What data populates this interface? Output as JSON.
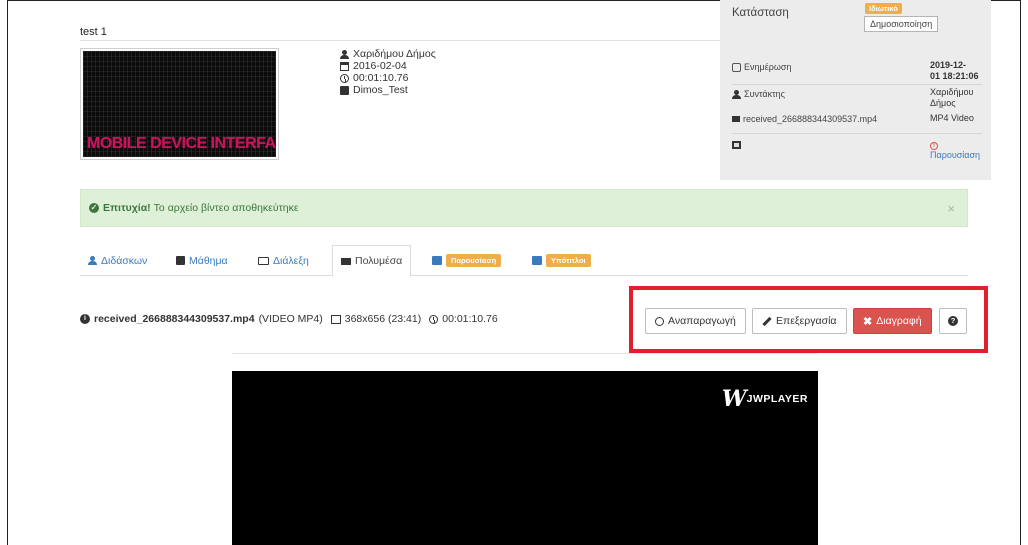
{
  "page": {
    "title": "test 1"
  },
  "thumbnail": {
    "logo_text": "MOBILE DEVICE INTERFACES",
    "logo_subtext": "MOBILE DEVICE INTERFACES"
  },
  "meta": {
    "author": "Χαριδήμου Δήμος",
    "date": "2016-02-04",
    "duration": "00:01:10.76",
    "course": "Dimos_Test"
  },
  "panel": {
    "status_label": "Κατάσταση",
    "status_badge": "Ιδιωτικό",
    "publish_button": "Δημοσιοποίηση",
    "updated_label": "Ενημέρωση",
    "updated_value_1": "2019-12-",
    "updated_value_2": "01 18:21:06",
    "editor_label": "Συντάκτης",
    "editor_value_1": "Χαριδήμου",
    "editor_value_2": "Δήμος",
    "file_label": "received_266888344309537.mp4",
    "file_value": "MP4 Video",
    "image_value": "Παρουσίαση",
    "warning_glyph": "!"
  },
  "alert": {
    "icon_glyph": "✓",
    "bold_text": "Επιτυχία!",
    "message": "Το αρχείο βίντεο αποθηκεύτηκε",
    "close_glyph": "×"
  },
  "tabs": [
    {
      "label": "Διδάσκων"
    },
    {
      "label": "Μάθημα"
    },
    {
      "label": "Διάλεξη"
    },
    {
      "label": "Πολυμέσα"
    },
    {
      "label": "Παρουσίαση"
    },
    {
      "label": "Υπότιτλοι"
    }
  ],
  "fileinfo": {
    "icon_glyph": "i",
    "filename": "received_266888344309537.mp4",
    "format": "(VIDEO MP4)",
    "dimensions": "368x656 (23:41)",
    "duration": "00:01:10.76"
  },
  "actions": {
    "play": "Αναπαραγωγή",
    "edit": "Επεξεργασία",
    "delete": "Διαγραφή",
    "delete_glyph": "✖",
    "help_glyph": "?"
  },
  "player": {
    "logo_mark": "W",
    "logo_text": "JWPLAYER"
  },
  "colors": {
    "accent": "#3a7bbf",
    "warning": "#f0ad4e",
    "danger": "#d9534f",
    "success_bg": "#dff0d8",
    "highlight_frame": "#e0202a"
  }
}
